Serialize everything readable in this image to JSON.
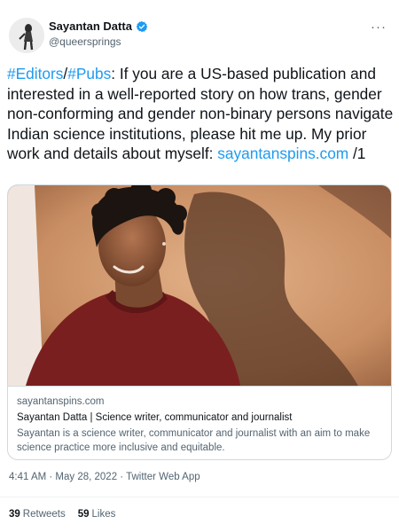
{
  "author": {
    "display_name": "Sayantan Datta",
    "handle": "@queersprings",
    "verified_icon": "verified-badge-icon",
    "avatar_icon": "avatar-illustration"
  },
  "more_label": "···",
  "tweet": {
    "hashtag1": "#Editors",
    "slash": "/",
    "hashtag2": "#Pubs",
    "body": ": If you are a US-based publication and interested in a well-reported story on how trans, gender non-conforming and gender non-binary persons navigate Indian science institutions, please hit me up. My prior work and details about myself: ",
    "link": "sayantanspins.com",
    "suffix": " /1"
  },
  "card": {
    "domain": "sayantanspins.com",
    "title": "Sayantan Datta | Science writer, communicator and journalist",
    "description": "Sayantan is a science writer, communicator and journalist with an aim to make science practice more inclusive and equitable."
  },
  "meta": {
    "timestamp": "4:41 AM · May 28, 2022 · Twitter Web App"
  },
  "stats": {
    "retweets_count": "39",
    "retweets_label": "Retweets",
    "likes_count": "59",
    "likes_label": "Likes"
  },
  "colors": {
    "accent": "#1d9bf0",
    "text": "#0f1419",
    "muted": "#536471",
    "border": "#cfd9de"
  }
}
